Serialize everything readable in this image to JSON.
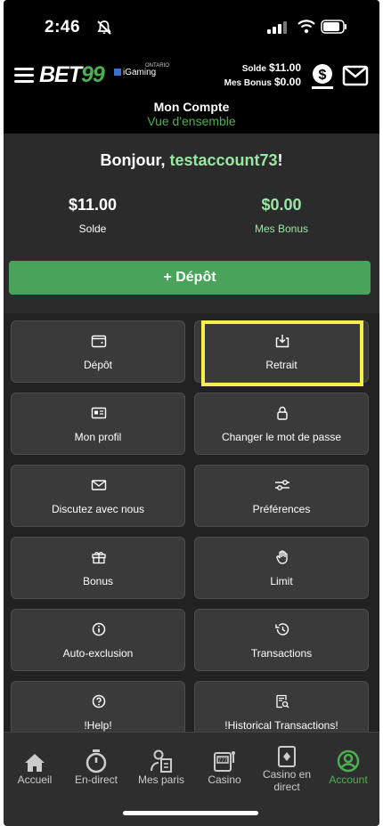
{
  "status_bar": {
    "time": "2:46"
  },
  "header": {
    "logo_text": "BET",
    "logo_accent": "99",
    "partner_label": "iGaming",
    "partner_sub": "ONTARIO",
    "balance_label": "Solde",
    "balance_value": "$11.00",
    "bonus_label": "Mes Bonus",
    "bonus_value": "$0.00",
    "title": "Mon Compte",
    "subtitle": "Vue d'ensemble"
  },
  "summary": {
    "greeting": "Bonjour,",
    "username": "testaccount73",
    "greeting_end": "!",
    "balance_amount": "$11.00",
    "balance_label": "Solde",
    "bonus_amount": "$0.00",
    "bonus_label": "Mes Bonus",
    "deposit_button": "+ Dépôt"
  },
  "tiles": [
    {
      "label": "Dépôt",
      "icon": "wallet-icon"
    },
    {
      "label": "Retrait",
      "icon": "withdraw-icon"
    },
    {
      "label": "Mon profil",
      "icon": "id-card-icon"
    },
    {
      "label": "Changer le mot de passe",
      "icon": "lock-icon"
    },
    {
      "label": "Discutez avec nous",
      "icon": "envelope-icon"
    },
    {
      "label": "Préférences",
      "icon": "sliders-icon"
    },
    {
      "label": "Bonus",
      "icon": "gift-icon"
    },
    {
      "label": "Limit",
      "icon": "hand-icon"
    },
    {
      "label": "Auto-exclusion",
      "icon": "info-icon"
    },
    {
      "label": "Transactions",
      "icon": "history-icon"
    },
    {
      "label": "!Help!",
      "icon": "help-icon"
    },
    {
      "label": "!Historical Transactions!",
      "icon": "receipt-search-icon"
    }
  ],
  "bottom_nav": [
    {
      "label": "Accueil",
      "icon": "home-icon"
    },
    {
      "label": "En-direct",
      "icon": "stopwatch-icon"
    },
    {
      "label": "Mes paris",
      "icon": "bet-slip-icon"
    },
    {
      "label": "Casino",
      "icon": "slot-machine-icon"
    },
    {
      "label": "Casino en direct",
      "icon": "card-icon"
    },
    {
      "label": "Account",
      "icon": "account-icon",
      "active": true
    }
  ],
  "colors": {
    "accent": "#4caf50",
    "highlight": "#f7f04a",
    "background": "#2b2b2b"
  }
}
